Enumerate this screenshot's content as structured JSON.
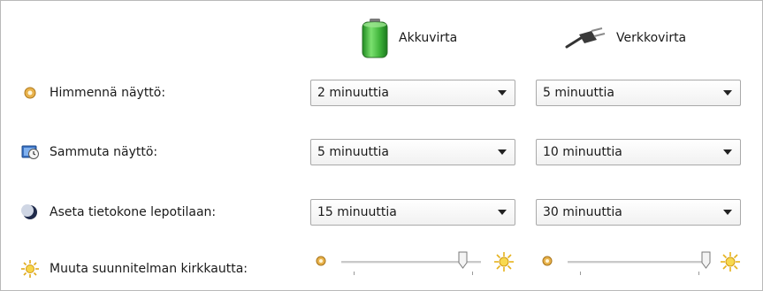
{
  "columns": {
    "battery_label": "Akkuvirta",
    "plugged_label": "Verkkovirta"
  },
  "rows": [
    {
      "label": "Himmennä näyttö:",
      "icon": "dim-display-icon",
      "battery": "2 minuuttia",
      "plugged": "5 minuuttia"
    },
    {
      "label": "Sammuta näyttö:",
      "icon": "display-off-icon",
      "battery": "5 minuuttia",
      "plugged": "10 minuuttia"
    },
    {
      "label": "Aseta tietokone lepotilaan:",
      "icon": "sleep-moon-icon",
      "battery": "15 minuuttia",
      "plugged": "30 minuuttia"
    }
  ],
  "brightness": {
    "label": "Muuta suunnitelman kirkkautta:",
    "icon": "brightness-sun-icon",
    "battery_level": 0.87,
    "plugged_level": 0.99
  },
  "colors": {
    "battery_green": "#3fb33a",
    "sun_yellow": "#f2c21c",
    "dim_orange": "#d9a23a"
  }
}
